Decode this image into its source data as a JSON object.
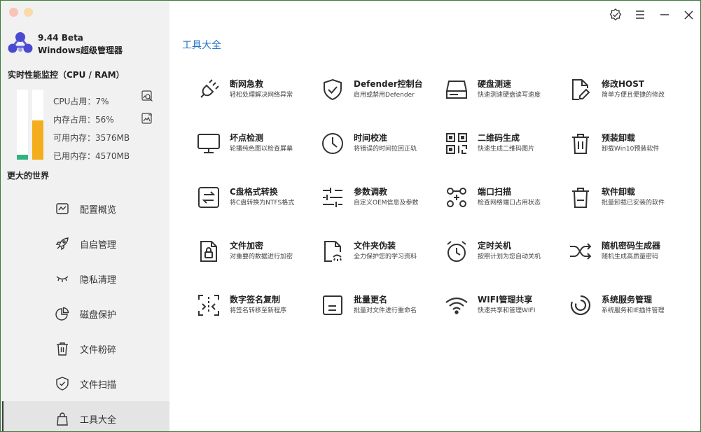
{
  "app": {
    "version": "9.44 Beta",
    "name": "Windows超级管理器"
  },
  "window_controls": {
    "icons": [
      "verified-icon",
      "menu-icon",
      "minimize-icon",
      "close-icon"
    ]
  },
  "performance": {
    "title": "实时性能监控（CPU / RAM）",
    "cpu_label": "CPU占用：7%",
    "cpu_percent": 7,
    "mem_label": "内存占用：56%",
    "mem_percent": 56,
    "available": "可用内存：3576MB",
    "used": "已用内存：4570MB",
    "colors": {
      "cpu": "#2fb37f",
      "mem": "#f3ad1d"
    }
  },
  "motto": "更大的世界",
  "nav": {
    "items": [
      {
        "label": "配置概览",
        "icon": "chart-icon"
      },
      {
        "label": "自启管理",
        "icon": "rocket-icon"
      },
      {
        "label": "隐私清理",
        "icon": "eye-closed-icon"
      },
      {
        "label": "磁盘保护",
        "icon": "pie-chart-icon"
      },
      {
        "label": "文件粉碎",
        "icon": "trash-icon"
      },
      {
        "label": "文件扫描",
        "icon": "shield-check-icon"
      },
      {
        "label": "工具大全",
        "icon": "bag-icon"
      }
    ],
    "active_index": 6
  },
  "main": {
    "section_title": "工具大全",
    "accent": "#1f6fc9",
    "tools": [
      {
        "name": "断网急救",
        "desc": "轻松处理解决网络异常",
        "icon": "plug-icon"
      },
      {
        "name": "Defender控制台",
        "desc": "启用或禁用Defender",
        "icon": "shield-check-icon"
      },
      {
        "name": "硬盘测速",
        "desc": "快速测速硬盘读写速度",
        "icon": "hard-drive-icon"
      },
      {
        "name": "修改HOST",
        "desc": "简单方便且便捷的修改",
        "icon": "file-edit-icon"
      },
      {
        "name": "坏点检测",
        "desc": "轮播纯色图以检查屏幕",
        "icon": "monitor-icon"
      },
      {
        "name": "时间校准",
        "desc": "将错误的时间拉回正轨",
        "icon": "clock-icon"
      },
      {
        "name": "二维码生成",
        "desc": "快速生成二维码图片",
        "icon": "qrcode-icon"
      },
      {
        "name": "预装卸载",
        "desc": "卸载Win10预装软件",
        "icon": "trash-icon"
      },
      {
        "name": "C盘格式转换",
        "desc": "将C盘转换为NTFS格式",
        "icon": "swap-icon"
      },
      {
        "name": "参数调教",
        "desc": "自定义OEM信息及参数",
        "icon": "sliders-icon"
      },
      {
        "name": "端口扫描",
        "desc": "检查网络端口占用状态",
        "icon": "scan-icon"
      },
      {
        "name": "软件卸载",
        "desc": "批量卸载已安装的软件",
        "icon": "trash-icon"
      },
      {
        "name": "文件加密",
        "desc": "对重要的数据进行加密",
        "icon": "file-lock-icon"
      },
      {
        "name": "文件夹伪装",
        "desc": "全力保护您的学习资料",
        "icon": "file-eye-icon"
      },
      {
        "name": "定时关机",
        "desc": "按照计划为您自动关机",
        "icon": "alarm-icon"
      },
      {
        "name": "随机密码生成器",
        "desc": "随机生成高质量密码",
        "icon": "shuffle-icon"
      },
      {
        "name": "数字签名复制",
        "desc": "将签名转移至新程序",
        "icon": "signature-copy-icon"
      },
      {
        "name": "批量更名",
        "desc": "批量对文件进行重命名",
        "icon": "rename-icon"
      },
      {
        "name": "WIFI管理共享",
        "desc": "快速共享和管理WIFI",
        "icon": "wifi-icon"
      },
      {
        "name": "系统服务管理",
        "desc": "系统服务和IE插件管理",
        "icon": "service-icon"
      }
    ]
  }
}
